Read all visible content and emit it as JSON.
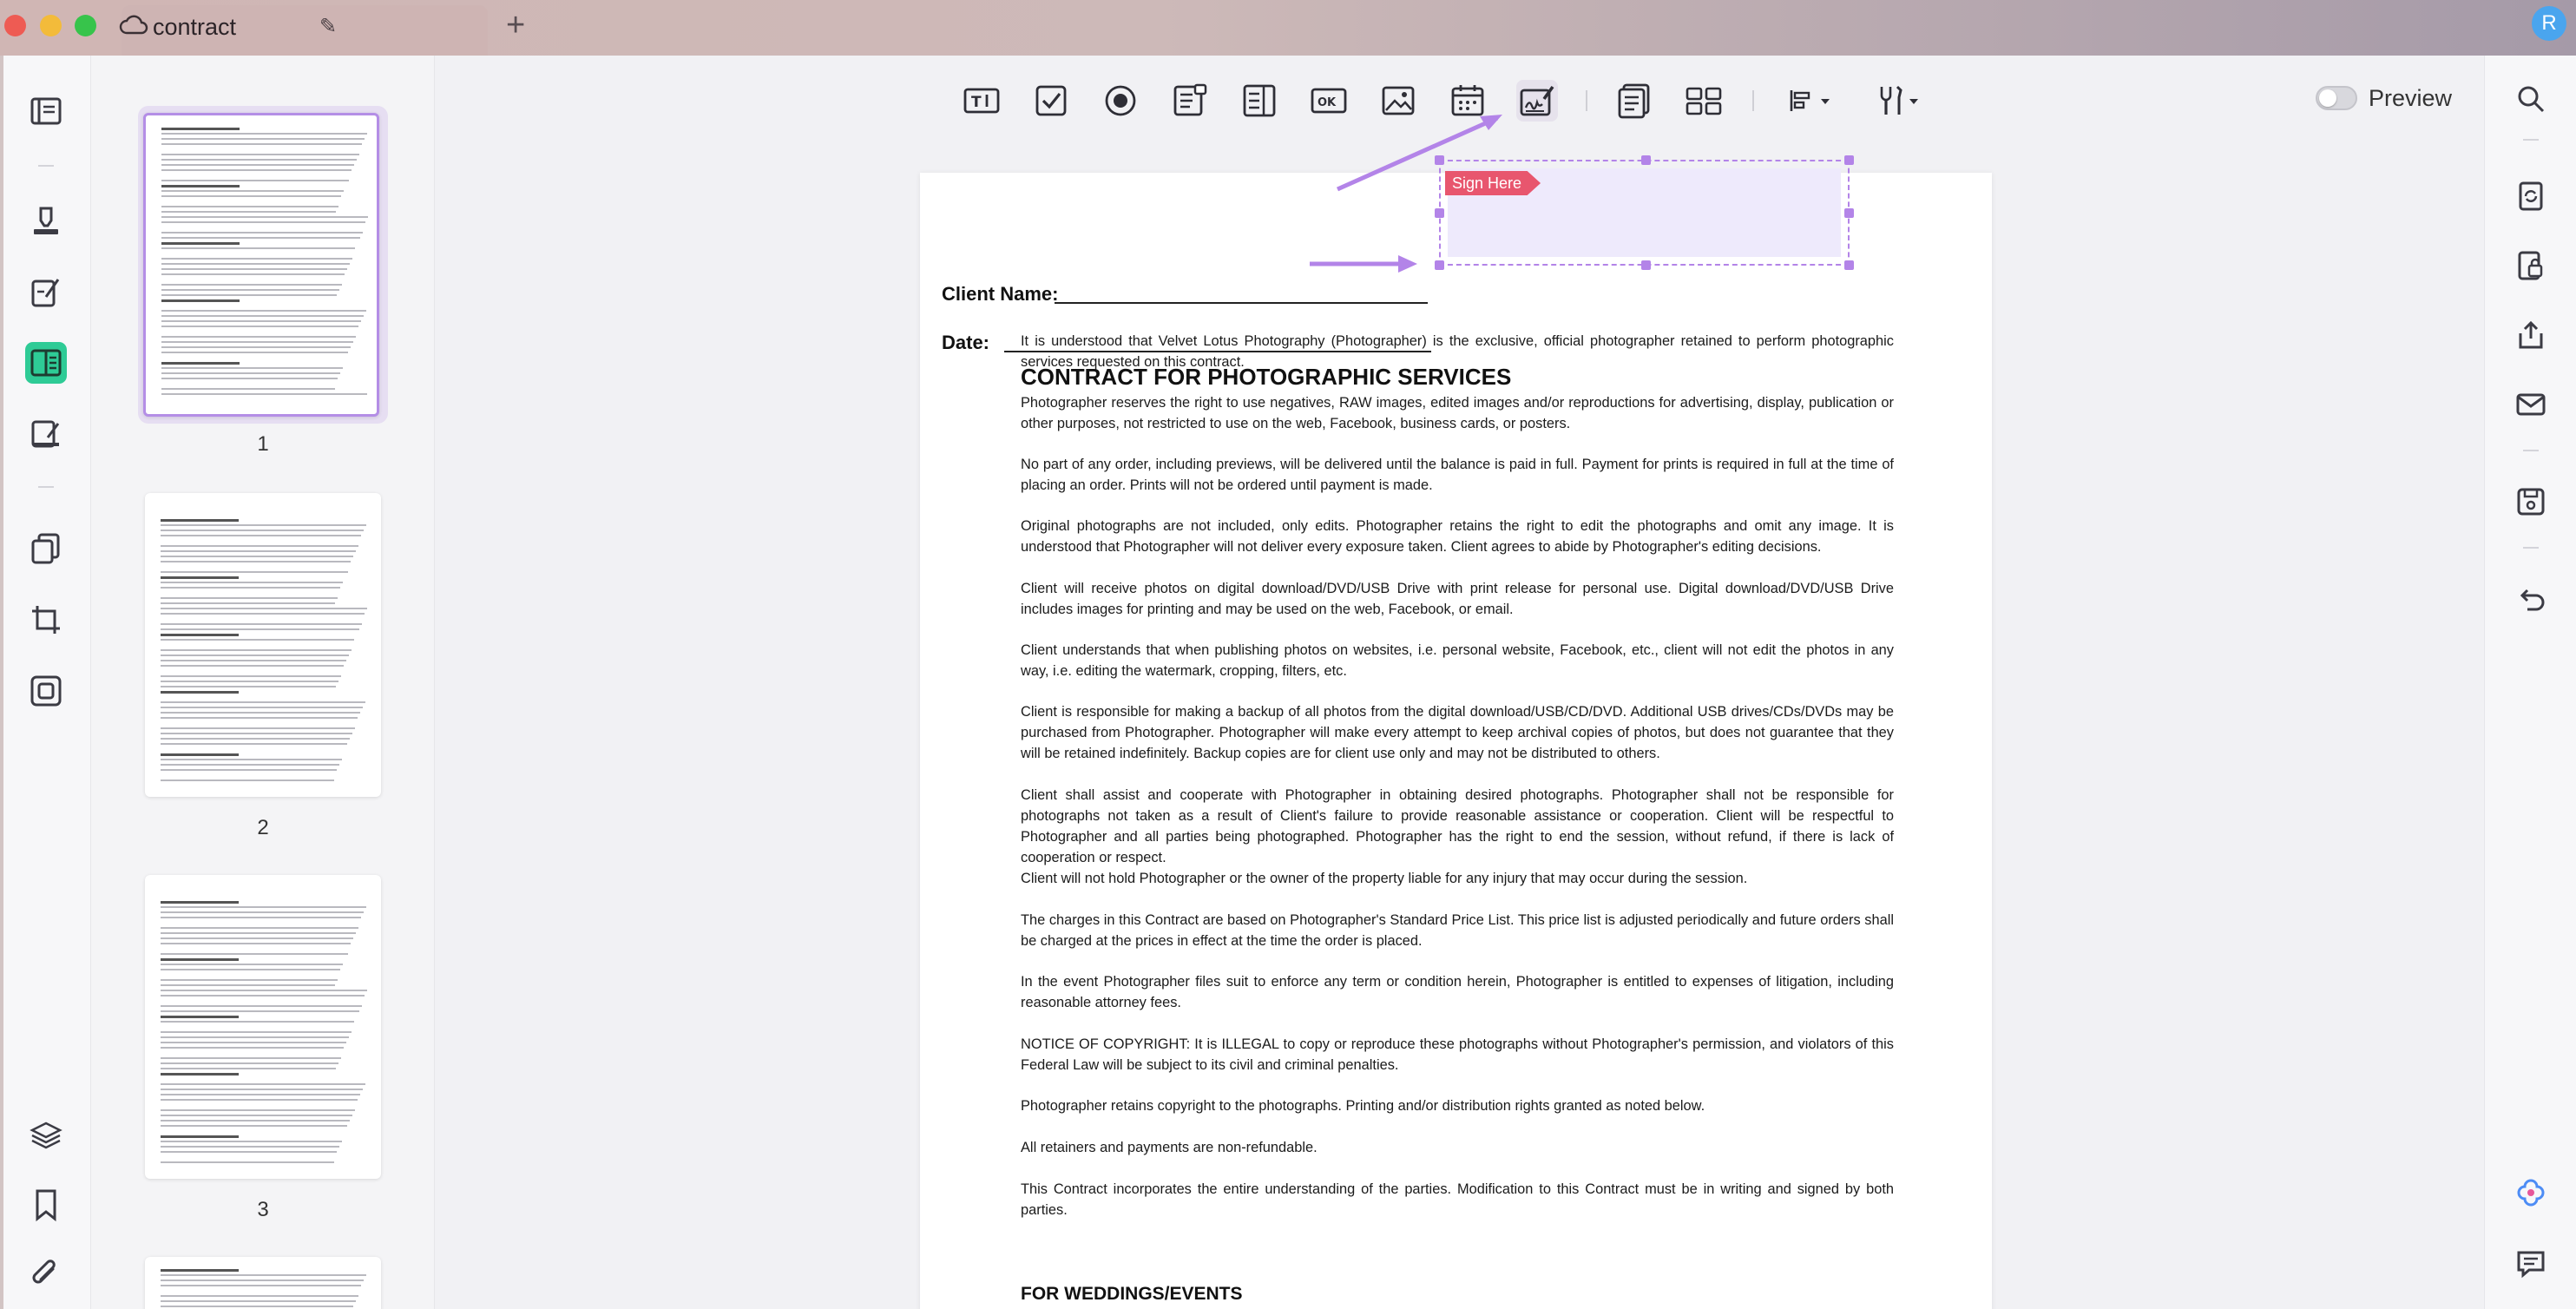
{
  "tab": {
    "title": "contract"
  },
  "user": {
    "initial": "R"
  },
  "toolbar": {
    "preview_label": "Preview",
    "icons": [
      "text-field-icon",
      "checkbox-icon",
      "radio-button-icon",
      "combo-box-icon",
      "list-box-icon",
      "button-icon",
      "image-field-icon",
      "date-field-icon",
      "signature-field-icon",
      "form-page-icon",
      "grid-arrange-icon",
      "align-icon",
      "tools-icon"
    ]
  },
  "thumbnails": [
    {
      "number": "1"
    },
    {
      "number": "2"
    },
    {
      "number": "3"
    }
  ],
  "page": {
    "client_name_label": "Client Name:",
    "date_label": "Date:",
    "sign_here": "Sign Here",
    "title": "CONTRACT FOR PHOTOGRAPHIC SERVICES",
    "paragraphs": [
      "It is understood that Velvet Lotus Photography (Photographer) is the exclusive, official photographer retained to perform photographic services requested on this contract.",
      "Photographer reserves the right to use negatives, RAW images, edited images and/or reproductions for advertising, display, publication or other purposes, not restricted to use on the web, Facebook, business cards, or posters.",
      "No part of any order, including previews, will be delivered until the balance is paid in full. Payment for prints is required in full at the time of placing an order. Prints will not be ordered until payment is made.",
      "Original photographs are not included, only edits. Photographer retains the right to edit the photographs and omit any image. It is understood that Photographer will not deliver every exposure taken. Client agrees to abide by Photographer's editing decisions.",
      "Client will receive photos on digital download/DVD/USB Drive with print release for personal use. Digital download/DVD/USB Drive includes images for printing and may be used on the web, Facebook, or email.",
      "Client understands that when publishing photos on websites, i.e. personal website, Facebook, etc., client will not edit the photos in any way, i.e. editing the watermark, cropping, filters, etc.",
      "Client is responsible for making a backup of all photos from the digital download/USB/CD/DVD. Additional USB drives/CDs/DVDs may be purchased from Photographer. Photographer will make every attempt to keep archival copies of photos, but does not guarantee that they will be retained indefinitely. Backup copies are for client use only and may not be distributed to others.",
      "Client shall assist and cooperate with Photographer in obtaining desired photographs. Photographer shall not be responsible for photographs not taken as a result of Client's failure to provide reasonable assistance or cooperation. Client will be respectful to Photographer and all parties being photographed. Photographer has the right to end the session, without refund, if there is lack of cooperation or respect.",
      "Client will not hold Photographer or the owner of the property liable for any injury that may occur during the session.",
      "The charges in this Contract are based on Photographer's Standard Price List. This price list is adjusted periodically and future orders shall be charged at the prices in effect at the time the order is placed.",
      "In the event Photographer files suit to enforce any term or condition herein, Photographer is entitled to expenses of litigation, including reasonable attorney fees.",
      "NOTICE OF COPYRIGHT: It is ILLEGAL to copy or reproduce these photographs without Photographer's permission, and violators of this Federal Law will be subject to its civil and criminal penalties.",
      "Photographer retains copyright to the photographs. Printing and/or distribution rights granted as noted below.",
      "All retainers and payments are non-refundable.",
      "This Contract incorporates the entire understanding of the parties. Modification to this Contract must be in writing and signed by both parties."
    ],
    "subtitle": "FOR WEDDINGS/EVENTS"
  },
  "colors": {
    "accent": "#b384e8",
    "sign_tag": "#e8566e",
    "rail_active": "#2ecb96"
  }
}
